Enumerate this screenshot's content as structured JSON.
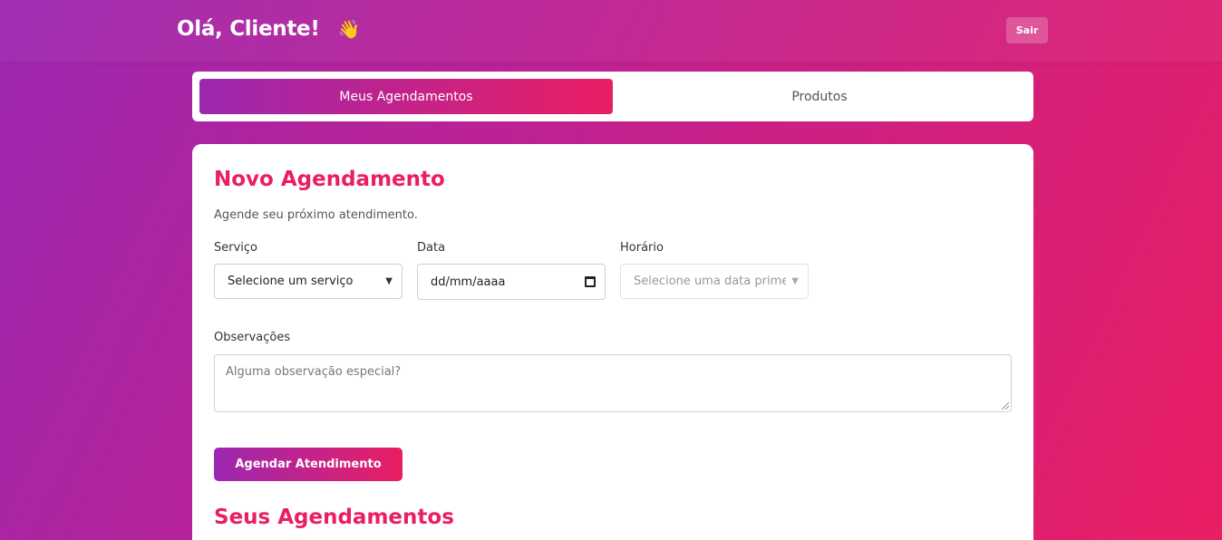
{
  "header": {
    "greeting": "Olá, Cliente!",
    "wave_icon": "👋",
    "logout_label": "Sair"
  },
  "tabs": [
    {
      "label": "Meus Agendamentos",
      "active": true
    },
    {
      "label": "Produtos",
      "active": false
    }
  ],
  "form": {
    "title": "Novo Agendamento",
    "subtitle": "Agende seu próximo atendimento.",
    "service": {
      "label": "Serviço",
      "value": "Selecione um serviço"
    },
    "date": {
      "label": "Data",
      "value": "dd/mm/aaaa"
    },
    "time": {
      "label": "Horário",
      "value": "Selecione uma data primeiro"
    },
    "notes": {
      "label": "Observações",
      "placeholder": "Alguma observação especial?"
    },
    "submit_label": "Agendar Atendimento"
  },
  "appointments": {
    "title": "Seus Agendamentos"
  },
  "colors": {
    "accent": "#e91e63",
    "gradient_start": "#9c27b0",
    "gradient_end": "#e91e63"
  }
}
